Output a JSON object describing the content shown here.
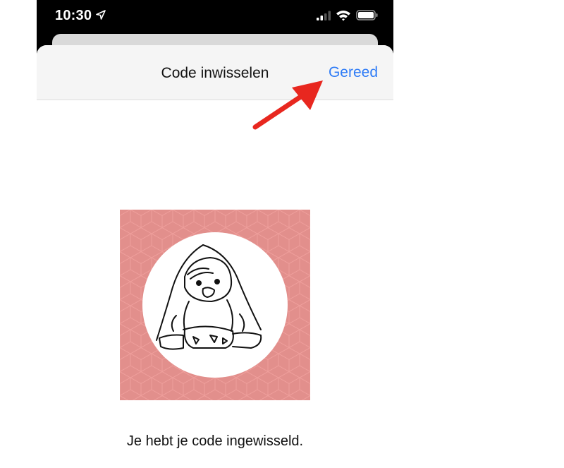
{
  "status_bar": {
    "time": "10:30",
    "icons": [
      "location-arrow-icon",
      "cellular-signal-icon",
      "wifi-icon",
      "battery-icon"
    ]
  },
  "nav": {
    "title": "Code inwisselen",
    "done_label": "Gereed"
  },
  "content": {
    "message": "Je hebt je code ingewisseld."
  },
  "annotation": {
    "icon": "red-arrow-icon"
  },
  "colors": {
    "accent": "#2f7cf6",
    "artwork_background": "#e28f8c",
    "arrow": "#e8271f"
  }
}
